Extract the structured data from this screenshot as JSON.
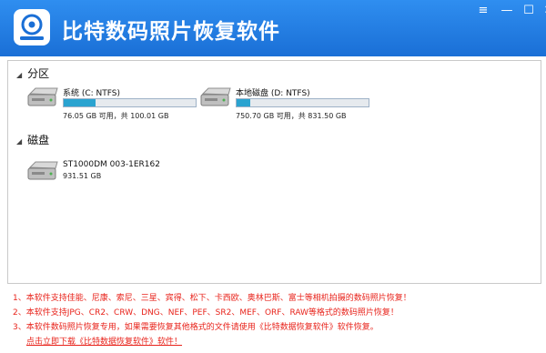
{
  "title": "比特数码照片恢复软件",
  "window_controls": {
    "menu": "≡",
    "minimize": "—",
    "maximize": "☐",
    "close": "✕"
  },
  "colors": {
    "titlebar": "#2585e6",
    "note_text": "#e8231b",
    "bar_fill": "#2aa3d0"
  },
  "partitions": {
    "heading": "分区",
    "items": [
      {
        "label": "系统 (C: NTFS)",
        "usage": "76.05 GB 可用，共 100.01 GB",
        "used_fraction": 0.24,
        "icon": "hard-drive-icon"
      },
      {
        "label": "本地磁盘 (D: NTFS)",
        "usage": "750.70 GB 可用，共 831.50 GB",
        "used_fraction": 0.1,
        "icon": "hard-drive-icon"
      }
    ]
  },
  "disks": {
    "heading": "磁盘",
    "items": [
      {
        "label": "ST1000DM 003-1ER162",
        "size": "931.51 GB",
        "icon": "hard-drive-icon"
      }
    ]
  },
  "notes": [
    "1、本软件支持佳能、尼康、索尼、三星、宾得、松下、卡西欧、奥林巴斯、富士等相机拍摄的数码照片恢复！",
    "2、本软件支持JPG、CR2、CRW、DNG、NEF、PEF、SR2、MEF、ORF、RAW等格式的数码照片恢复！",
    "3、本软件数码照片恢复专用，如果需要恢复其他格式的文件请使用《比特数据恢复软件》软件恢复。"
  ],
  "download_link": "点击立即下载《比特数据恢复软件》软件！"
}
